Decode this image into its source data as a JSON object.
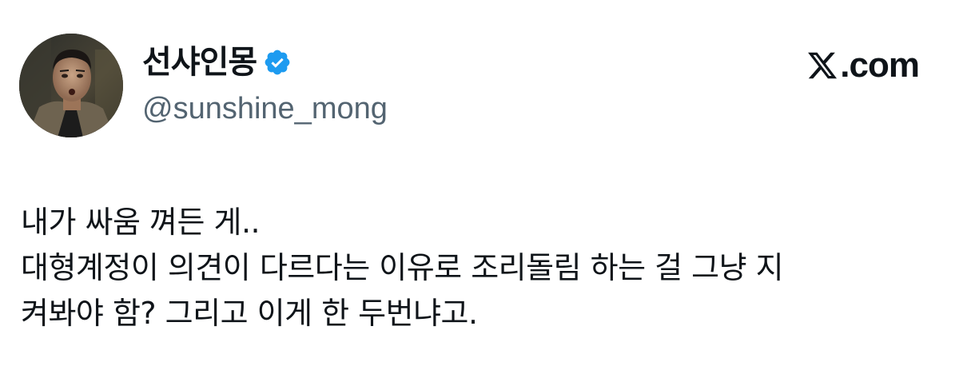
{
  "author": {
    "display_name": "선샤인몽",
    "handle": "@sunshine_mong",
    "verified": true,
    "avatar_icon": "profile-photo"
  },
  "brand": {
    "logo_icon": "x-logo-icon",
    "text": ".com"
  },
  "tweet": {
    "lines": [
      "내가 싸움 껴든 게..",
      "대형계정이 의견이 다르다는 이유로 조리돌림 하는 걸 그냥 지",
      "켜봐야 함? 그리고 이게 한 두번냐고."
    ]
  },
  "colors": {
    "verified_blue": "#1d9bf0",
    "text_primary": "#0f1419",
    "text_secondary": "#536471"
  }
}
